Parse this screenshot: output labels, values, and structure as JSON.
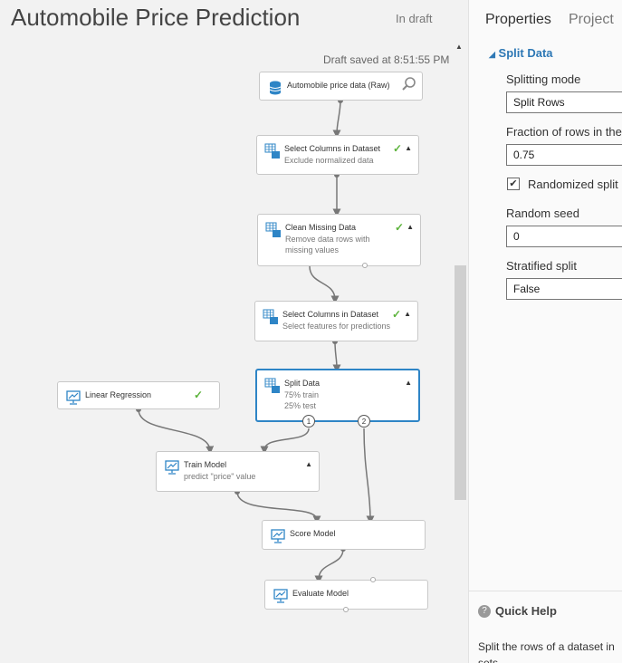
{
  "header": {
    "title": "Automobile Price Prediction",
    "status": "In draft"
  },
  "canvas": {
    "saved_text": "Draft saved at 8:51:55 PM"
  },
  "modules": {
    "dataset": {
      "name": "Automobile price data (Raw)"
    },
    "select1": {
      "name": "Select Columns in Dataset",
      "sub": "Exclude normalized data"
    },
    "clean": {
      "name": "Clean Missing Data",
      "sub": "Remove data rows with\nmissing values"
    },
    "select2": {
      "name": "Select Columns in Dataset",
      "sub": "Select features for predictions"
    },
    "split": {
      "name": "Split Data",
      "sub": "75% train\n25% test",
      "port1": "1",
      "port2": "2"
    },
    "linreg": {
      "name": "Linear Regression"
    },
    "train": {
      "name": "Train Model",
      "sub": "predict \"price\" value"
    },
    "score": {
      "name": "Score Model"
    },
    "evaluate": {
      "name": "Evaluate Model"
    }
  },
  "panel": {
    "tabs": [
      "Properties",
      "Project"
    ],
    "section": "Split Data",
    "splitting_mode_label": "Splitting mode",
    "splitting_mode_value": "Split Rows",
    "fraction_label": "Fraction of rows in the",
    "fraction_value": "0.75",
    "randomized_label": "Randomized split",
    "randomized_checked": true,
    "seed_label": "Random seed",
    "seed_value": "0",
    "stratified_label": "Stratified split",
    "stratified_value": "False"
  },
  "quick_help": {
    "title": "Quick Help",
    "text": "Split the rows of a dataset in sets"
  },
  "colors": {
    "accent": "#2e85c6",
    "check": "#5cb33b",
    "section": "#2e78b5"
  }
}
